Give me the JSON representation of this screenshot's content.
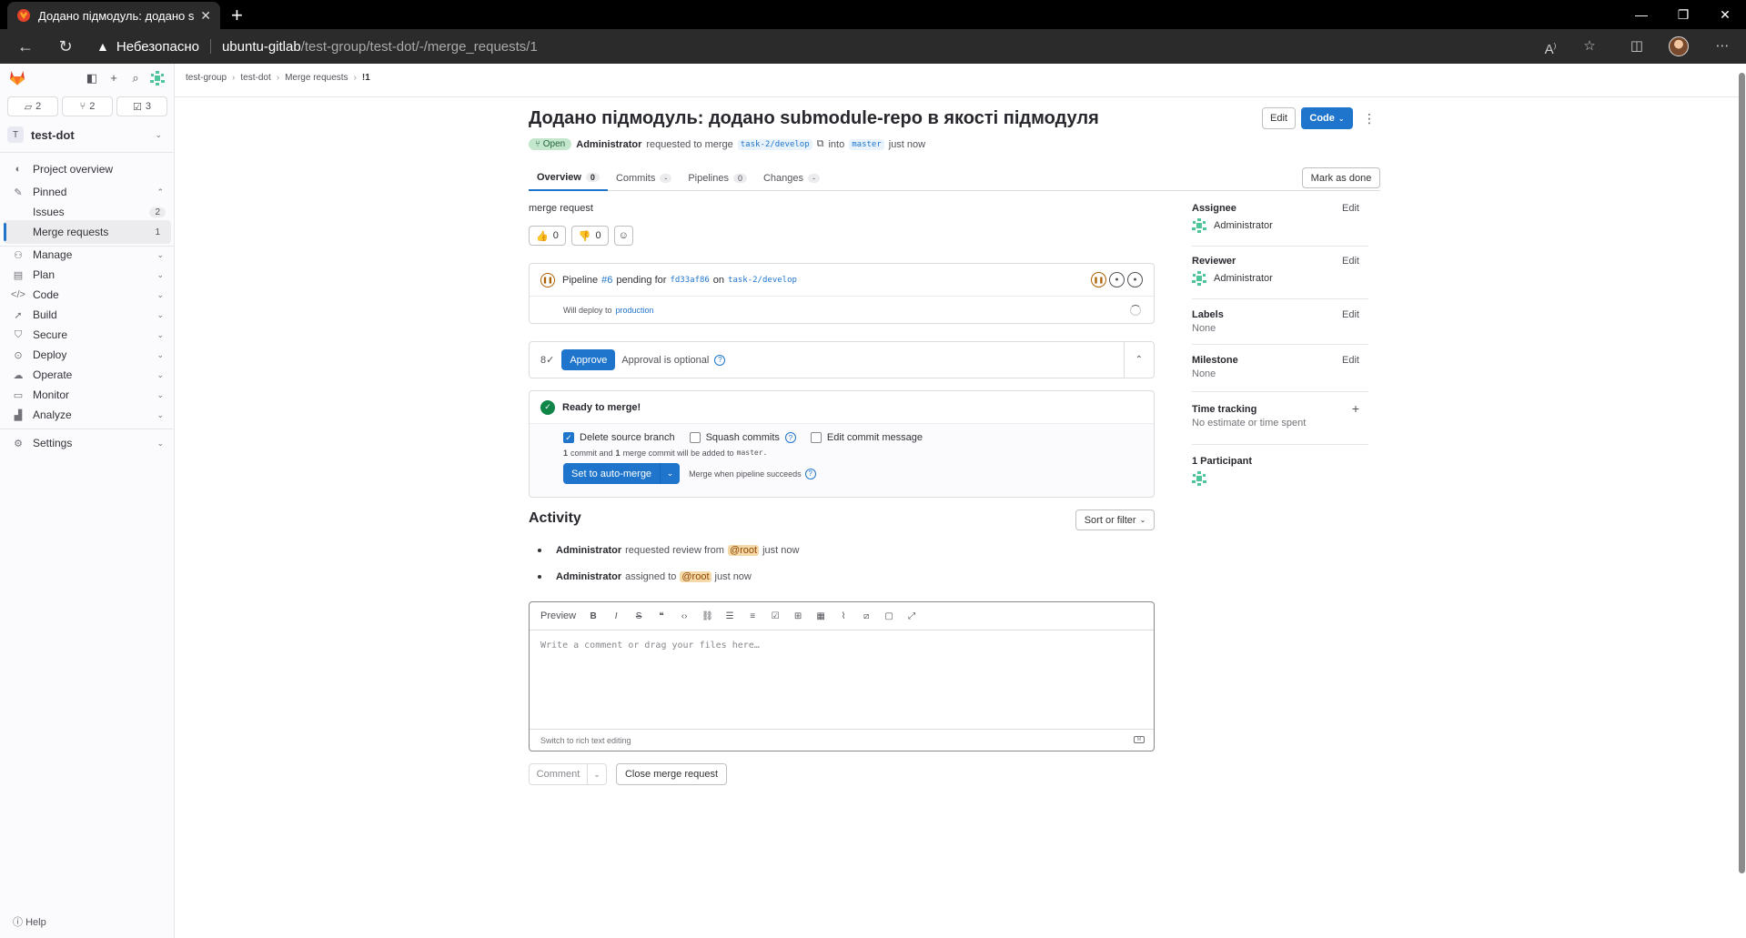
{
  "browser": {
    "tab_title": "Додано підмодуль: додано sub",
    "security_label": "Небезопасно",
    "url_host": "ubuntu-gitlab",
    "url_path": "/test-group/test-dot/-/merge_requests/1"
  },
  "sidebar": {
    "counts": [
      {
        "icon": "issues-icon",
        "value": "2"
      },
      {
        "icon": "merge-request-icon",
        "value": "2"
      },
      {
        "icon": "todo-icon",
        "value": "3"
      }
    ],
    "project_initial": "T",
    "project_name": "test-dot",
    "project_overview": "Project overview",
    "pinned": "Pinned",
    "issues": "Issues",
    "issues_count": "2",
    "merge_requests": "Merge requests",
    "merge_requests_count": "1",
    "manage": "Manage",
    "plan": "Plan",
    "code": "Code",
    "build": "Build",
    "secure": "Secure",
    "deploy": "Deploy",
    "operate": "Operate",
    "monitor": "Monitor",
    "analyze": "Analyze",
    "settings": "Settings",
    "help": "Help"
  },
  "breadcrumbs": [
    "test-group",
    "test-dot",
    "Merge requests",
    "!1"
  ],
  "mr": {
    "title": "Додано підмодуль: додано submodule-repo в якості підмодуля",
    "edit": "Edit",
    "code": "Code",
    "status": "Open",
    "author": "Administrator",
    "requested_text": "requested to merge",
    "source_branch": "task-2/develop",
    "into_text": "into",
    "target_branch": "master",
    "time": "just now"
  },
  "tabs": [
    {
      "label": "Overview",
      "count": "0"
    },
    {
      "label": "Commits",
      "count": "-"
    },
    {
      "label": "Pipelines",
      "count": "0"
    },
    {
      "label": "Changes",
      "count": "-"
    }
  ],
  "mark_done": "Mark as done",
  "description": "merge request",
  "reactions": {
    "thumbs_up": "0",
    "thumbs_down": "0"
  },
  "pipeline": {
    "prefix": "Pipeline",
    "id": "#6",
    "pending_for": "pending for",
    "commit": "fd33af86",
    "on": "on",
    "branch": "task-2/develop",
    "deploy_prefix": "Will deploy to",
    "environment": "production"
  },
  "approval": {
    "button": "Approve",
    "text": "Approval is optional"
  },
  "merge": {
    "ready": "Ready to merge!",
    "delete_branch": "Delete source branch",
    "squash": "Squash commits",
    "edit_message": "Edit commit message",
    "info_count1": "1",
    "info_mid": "commit and",
    "info_count2": "1",
    "info_tail": "merge commit will be added to",
    "info_branch": "master.",
    "button": "Set to auto-merge",
    "when": "Merge when pipeline succeeds"
  },
  "activity": {
    "heading": "Activity",
    "sort": "Sort or filter",
    "items": [
      {
        "actor": "Administrator",
        "action": "requested review from",
        "mention": "@root",
        "time": "just now"
      },
      {
        "actor": "Administrator",
        "action": "assigned to",
        "mention": "@root",
        "time": "just now"
      }
    ]
  },
  "editor": {
    "preview": "Preview",
    "placeholder": "Write a comment or drag your files here…",
    "switch": "Switch to rich text editing",
    "comment": "Comment",
    "close": "Close merge request"
  },
  "right": {
    "assignee_title": "Assignee",
    "assignee": "Administrator",
    "reviewer_title": "Reviewer",
    "reviewer": "Administrator",
    "labels_title": "Labels",
    "labels": "None",
    "milestone_title": "Milestone",
    "milestone": "None",
    "time_title": "Time tracking",
    "time_value": "No estimate or time spent",
    "participants": "1 Participant",
    "edit": "Edit"
  }
}
